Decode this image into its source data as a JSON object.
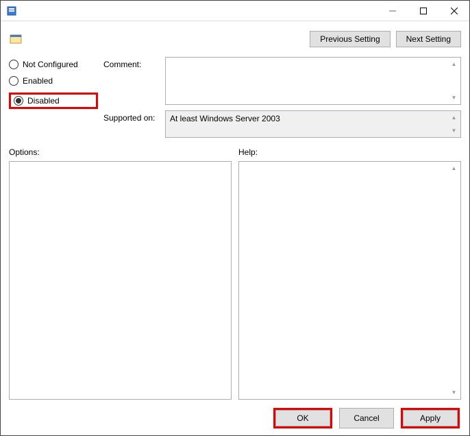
{
  "titlebar": {
    "title": ""
  },
  "nav": {
    "prev": "Previous Setting",
    "next": "Next Setting"
  },
  "radios": {
    "not_configured": "Not Configured",
    "enabled": "Enabled",
    "disabled": "Disabled"
  },
  "fields": {
    "comment_label": "Comment:",
    "comment_value": "",
    "supported_label": "Supported on:",
    "supported_value": "At least Windows Server 2003"
  },
  "panels": {
    "options_label": "Options:",
    "options_value": "",
    "help_label": "Help:",
    "help_value": ""
  },
  "buttons": {
    "ok": "OK",
    "cancel": "Cancel",
    "apply": "Apply"
  }
}
